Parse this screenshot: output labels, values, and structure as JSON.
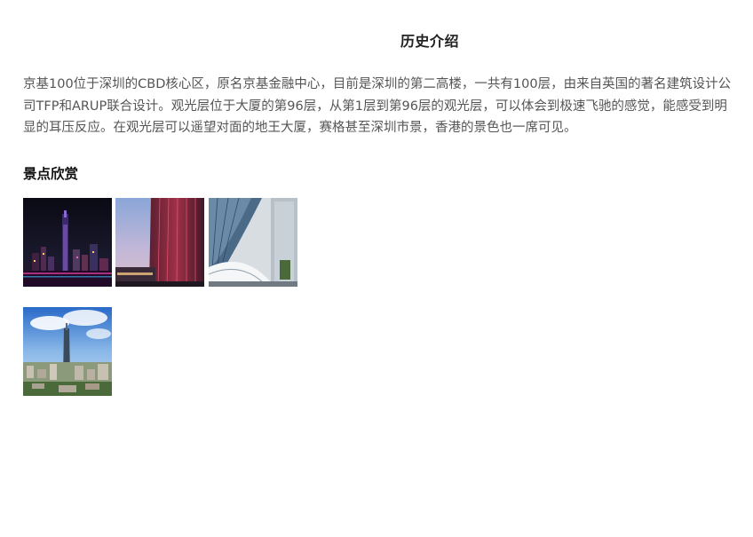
{
  "history": {
    "title": "历史介绍",
    "intro": "京基100位于深圳的CBD核心区，原名京基金融中心，目前是深圳的第二高楼，一共有100层，由来自英国的著名建筑设计公司TFP和ARUP联合设计。观光层位于大厦的第96层，从第1层到第96层的观光层，可以体会到极速飞驰的感觉，能感受到明显的耳压反应。在观光层可以遥望对面的地王大厦，赛格甚至深圳市景，香港的景色也一席可见。"
  },
  "scenery": {
    "title": "景点欣赏",
    "photos": [
      {
        "subject": "night-skyline"
      },
      {
        "subject": "tower-facade-dusk"
      },
      {
        "subject": "curved-glass-building"
      },
      {
        "subject": "aerial-city-tower"
      }
    ]
  }
}
